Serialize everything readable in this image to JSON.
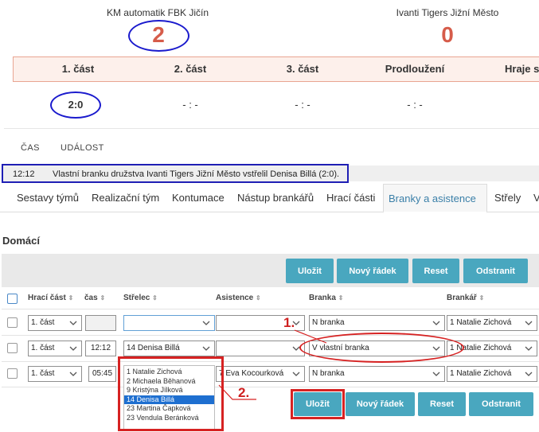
{
  "match": {
    "home": {
      "name": "KM automatik FBK Jičín",
      "score": "2"
    },
    "away": {
      "name": "Ivanti Tigers Jižní Město",
      "score": "0"
    },
    "periods": [
      {
        "label": "1. část",
        "score": "2:0"
      },
      {
        "label": "2. část",
        "score": "- : -"
      },
      {
        "label": "3. část",
        "score": "- : -"
      },
      {
        "label": "Prodloužení",
        "score": "- : -"
      },
      {
        "label": "Hraje s",
        "score": ""
      }
    ]
  },
  "events": {
    "headers": {
      "time": "ČAS",
      "event": "UDÁLOST"
    },
    "rows": [
      {
        "time": "12:12",
        "text": "Vlastní branku družstva Ivanti Tigers Jižní Město vstřelil Denisa Billá (2:0)."
      }
    ]
  },
  "tabs": [
    {
      "label": "Sestavy týmů",
      "active": false
    },
    {
      "label": "Realizační tým",
      "active": false
    },
    {
      "label": "Kontumace",
      "active": false
    },
    {
      "label": "Nástup brankářů",
      "active": false
    },
    {
      "label": "Hrací části",
      "active": false
    },
    {
      "label": "Branky a asistence",
      "active": true
    },
    {
      "label": "Střely",
      "active": false
    },
    {
      "label": "V",
      "active": false
    }
  ],
  "section": {
    "title": "Domácí",
    "toolbar": {
      "save": "Uložit",
      "new_row": "Nový řádek",
      "reset": "Reset",
      "remove": "Odstranit"
    },
    "columns": {
      "period": "Hrací část",
      "time": "čas",
      "shooter": "Střelec",
      "assist": "Asistence",
      "goal": "Branka",
      "goalie": "Brankář"
    },
    "rows": [
      {
        "period": "1. část",
        "time": "",
        "shooter": "",
        "assist": "",
        "goal": "N branka",
        "goalie": "1 Natalie Zichová"
      },
      {
        "period": "1. část",
        "time": "12:12",
        "shooter": "14 Denisa Billá",
        "assist": "",
        "goal": "V vlastní branka",
        "goalie": "1 Natalie Zichová"
      },
      {
        "period": "1. část",
        "time": "05:45",
        "shooter": "",
        "assist": "7 Eva Kocourková",
        "goal": "N branka",
        "goalie": "1 Natalie Zichová"
      }
    ],
    "shooter_options": [
      {
        "label": "1 Natalie Zichová",
        "selected": false
      },
      {
        "label": "2 Michaela Běhanová",
        "selected": false
      },
      {
        "label": "9 Kristýna Jílková",
        "selected": false
      },
      {
        "label": "14 Denisa Billá",
        "selected": true
      },
      {
        "label": "23 Martina Čapková",
        "selected": false
      },
      {
        "label": "23 Vendula Beránková",
        "selected": false
      }
    ],
    "bottom_toolbar": {
      "save": "Uložit",
      "new_row": "Nový řádek",
      "reset": "Reset",
      "remove": "Odstranit"
    }
  },
  "annotations": {
    "step1": "1.",
    "step2": "2."
  },
  "colors": {
    "score": "#d65c4a",
    "button": "#49a7bf",
    "active_tab": "#3a7fa8",
    "annotation_red": "#d62222",
    "annotation_blue": "#1a1acd",
    "list_selected": "#1e6fd0"
  },
  "icons": {
    "dropdown": "chevron-down-icon",
    "sort": "sort-arrows-icon"
  }
}
